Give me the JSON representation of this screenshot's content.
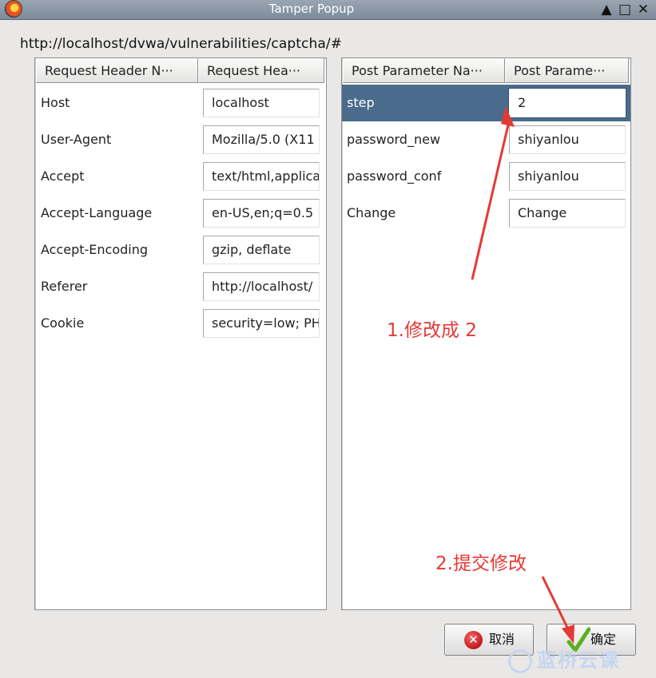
{
  "window": {
    "title": "Tamper Popup",
    "controls": [
      "▲",
      "□",
      "✕"
    ]
  },
  "url": "http://localhost/dvwa/vulnerabilities/captcha/#",
  "headers_table": {
    "columns": [
      "Request Header N···",
      "Request Hea···"
    ],
    "rows": [
      {
        "name": "Host",
        "value": "localhost"
      },
      {
        "name": "User-Agent",
        "value": "Mozilla/5.0 (X11"
      },
      {
        "name": "Accept",
        "value": "text/html,applica"
      },
      {
        "name": "Accept-Language",
        "value": "en-US,en;q=0.5"
      },
      {
        "name": "Accept-Encoding",
        "value": "gzip, deflate"
      },
      {
        "name": "Referer",
        "value": "http://localhost/"
      },
      {
        "name": "Cookie",
        "value": "security=low; PH"
      }
    ]
  },
  "post_table": {
    "columns": [
      "Post Parameter Na···",
      "Post Parame···"
    ],
    "rows": [
      {
        "name": "step",
        "value": "2",
        "selected": true
      },
      {
        "name": "password_new",
        "value": "shiyanlou"
      },
      {
        "name": "password_conf",
        "value": "shiyanlou"
      },
      {
        "name": "Change",
        "value": "Change"
      }
    ]
  },
  "buttons": {
    "cancel": "取消",
    "ok": "确定"
  },
  "annotations": {
    "step1": "1.修改成 2",
    "step2": "2.提交修改"
  },
  "watermark": "蓝桥云课",
  "colors": {
    "selection": "#4a6b8c",
    "annotation": "#e53935",
    "titlebar": "#8b97a6"
  }
}
